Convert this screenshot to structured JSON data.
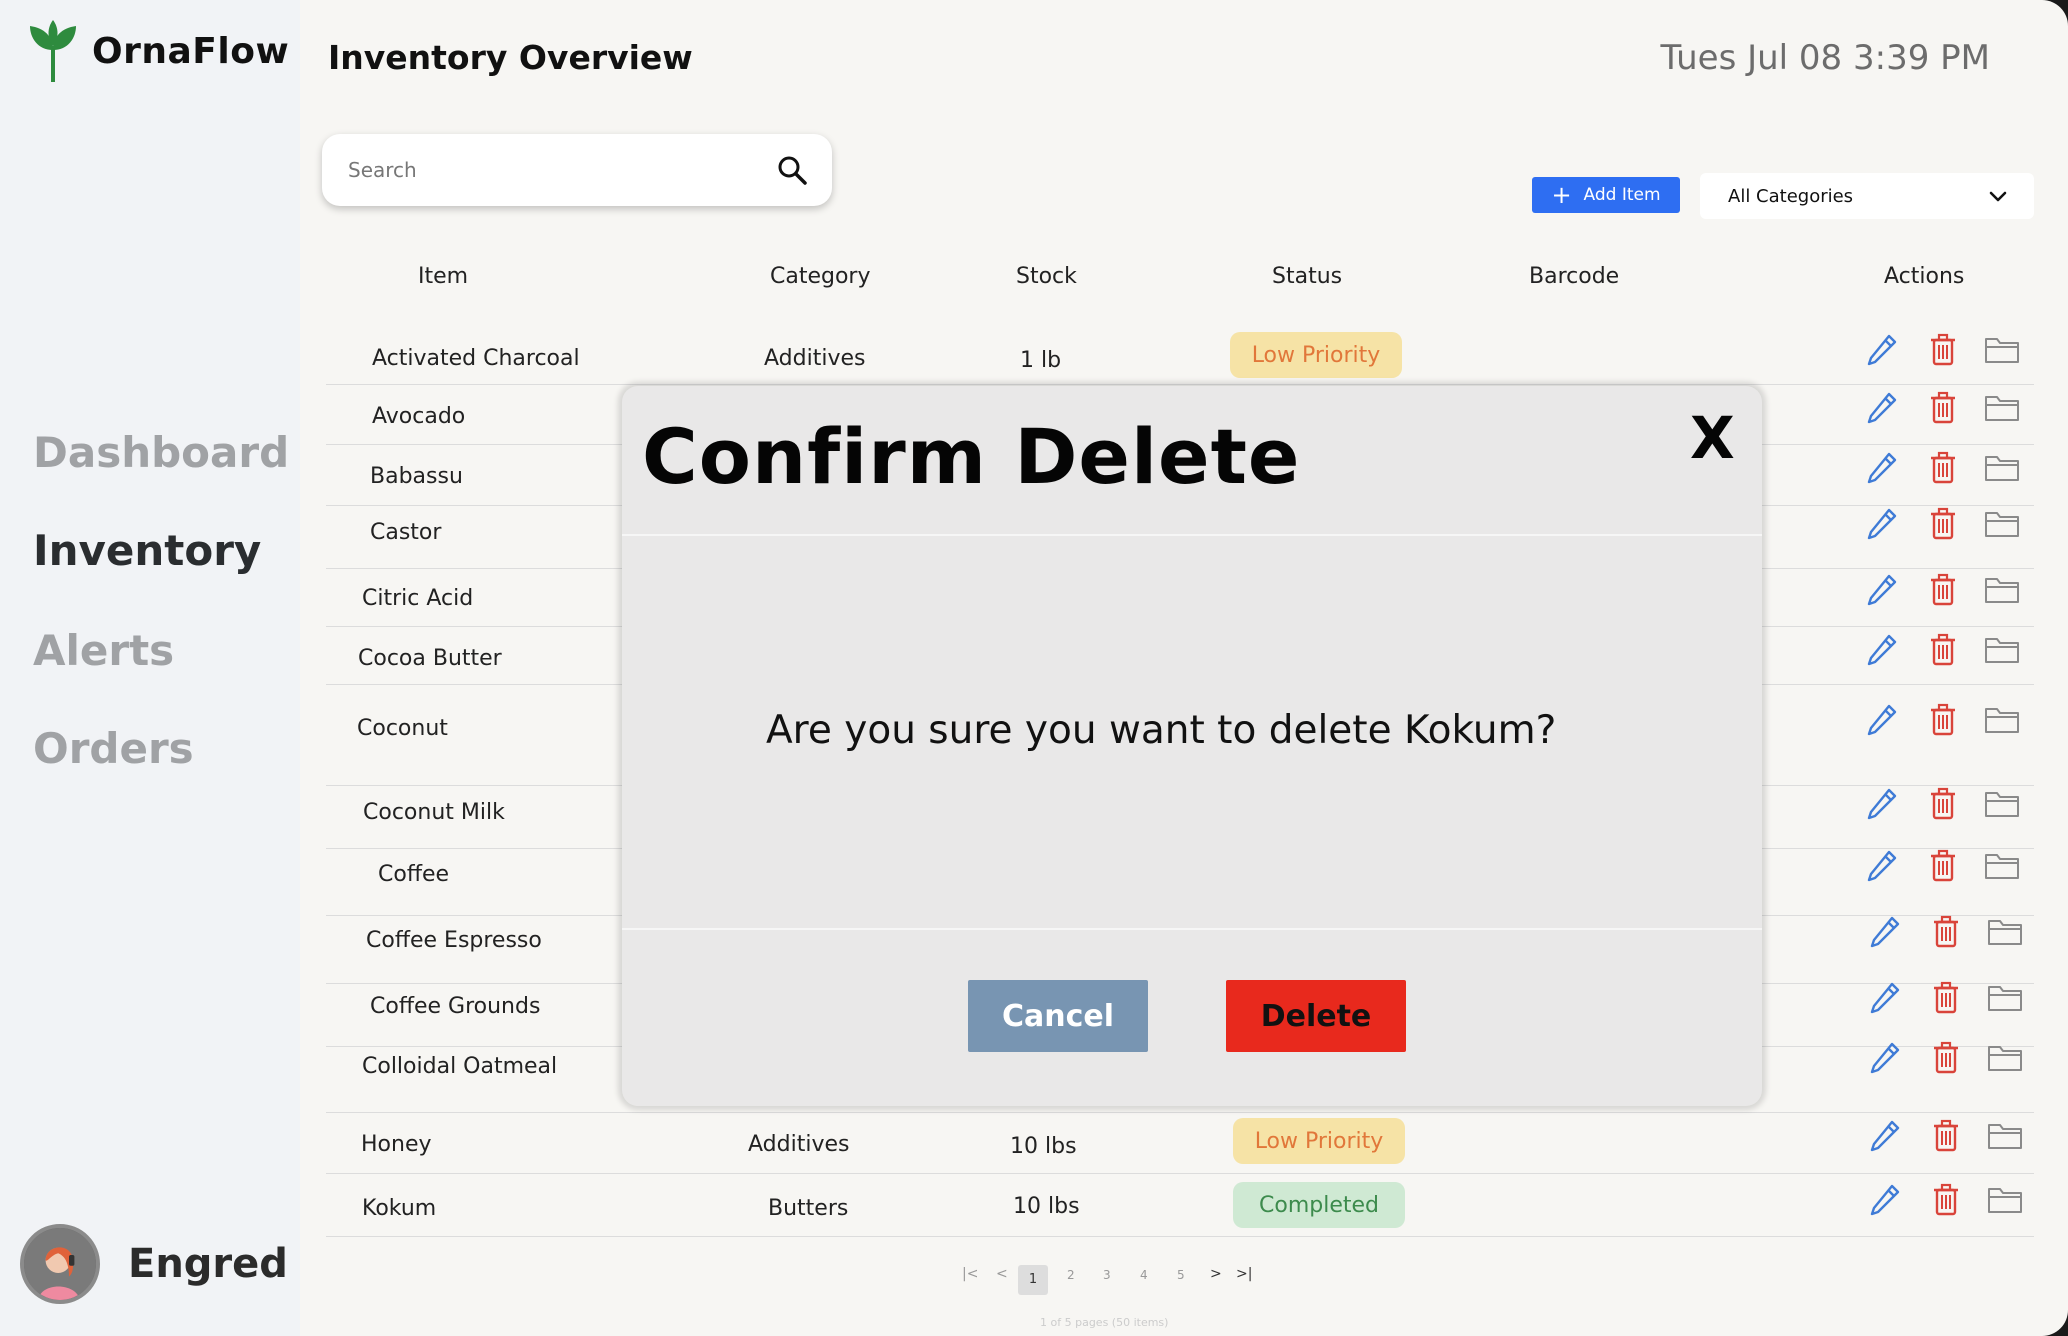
{
  "app": {
    "name": "OrnaFlow"
  },
  "header": {
    "title": "Inventory Overview",
    "datetime": "Tues Jul 08 3:39 PM"
  },
  "sidebar": {
    "items": [
      {
        "label": "Dashboard",
        "active": false
      },
      {
        "label": "Inventory",
        "active": true
      },
      {
        "label": "Alerts",
        "active": false
      },
      {
        "label": "Orders",
        "active": false
      }
    ],
    "user": {
      "name": "Engred"
    }
  },
  "search": {
    "placeholder": "Search",
    "value": ""
  },
  "toolbar": {
    "add_label": "Add Item",
    "category_selected": "All Categories"
  },
  "table": {
    "columns": [
      "Item",
      "Category",
      "Stock",
      "Status",
      "Barcode",
      "Actions"
    ],
    "rows": [
      {
        "item": "Activated Charcoal",
        "category": "Additives",
        "stock": "1 lb",
        "status": "Low Priority"
      },
      {
        "item": "Avocado",
        "category": "",
        "stock": "",
        "status": ""
      },
      {
        "item": "Babassu",
        "category": "",
        "stock": "",
        "status": ""
      },
      {
        "item": "Castor",
        "category": "",
        "stock": "",
        "status": ""
      },
      {
        "item": "Citric Acid",
        "category": "",
        "stock": "",
        "status": ""
      },
      {
        "item": "Cocoa Butter",
        "category": "",
        "stock": "",
        "status": ""
      },
      {
        "item": "Coconut",
        "category": "",
        "stock": "",
        "status": ""
      },
      {
        "item": "Coconut Milk",
        "category": "",
        "stock": "",
        "status": ""
      },
      {
        "item": "Coffee",
        "category": "",
        "stock": "",
        "status": ""
      },
      {
        "item": "Coffee Espresso",
        "category": "",
        "stock": "",
        "status": ""
      },
      {
        "item": "Coffee Grounds",
        "category": "",
        "stock": "",
        "status": ""
      },
      {
        "item": "Colloidal Oatmeal",
        "category": "",
        "stock": "",
        "status": ""
      },
      {
        "item": "Honey",
        "category": "Additives",
        "stock": "10 lbs",
        "status": "Low Priority"
      },
      {
        "item": "Kokum",
        "category": "Butters",
        "stock": "10 lbs",
        "status": "Completed"
      }
    ]
  },
  "pagination": {
    "pages": [
      "1",
      "2",
      "3",
      "4",
      "5"
    ],
    "current": "1",
    "first": "|<",
    "prev": "<",
    "next": ">",
    "last": ">|",
    "info": "1 of 5 pages (50 items)"
  },
  "modal": {
    "title": "Confirm Delete",
    "close_label": "X",
    "message": "Are you sure you want to delete Kokum?",
    "cancel_label": "Cancel",
    "delete_label": "Delete"
  },
  "colors": {
    "accent_blue": "#2e6ef2",
    "danger_red": "#e8291d",
    "cancel_blue_gray": "#7895b2",
    "low_priority_bg": "#f6e3a6",
    "low_priority_text": "#e1773a",
    "completed_bg": "#cfe9d3",
    "completed_text": "#3d8b4d",
    "brand_green": "#2e8b3e"
  },
  "icons": {
    "logo": "leaf-sprout-icon",
    "search": "search-icon",
    "add": "plus-icon",
    "dropdown": "chevron-down-icon",
    "edit": "pencil-icon",
    "delete": "trash-icon",
    "archive": "folder-icon"
  }
}
